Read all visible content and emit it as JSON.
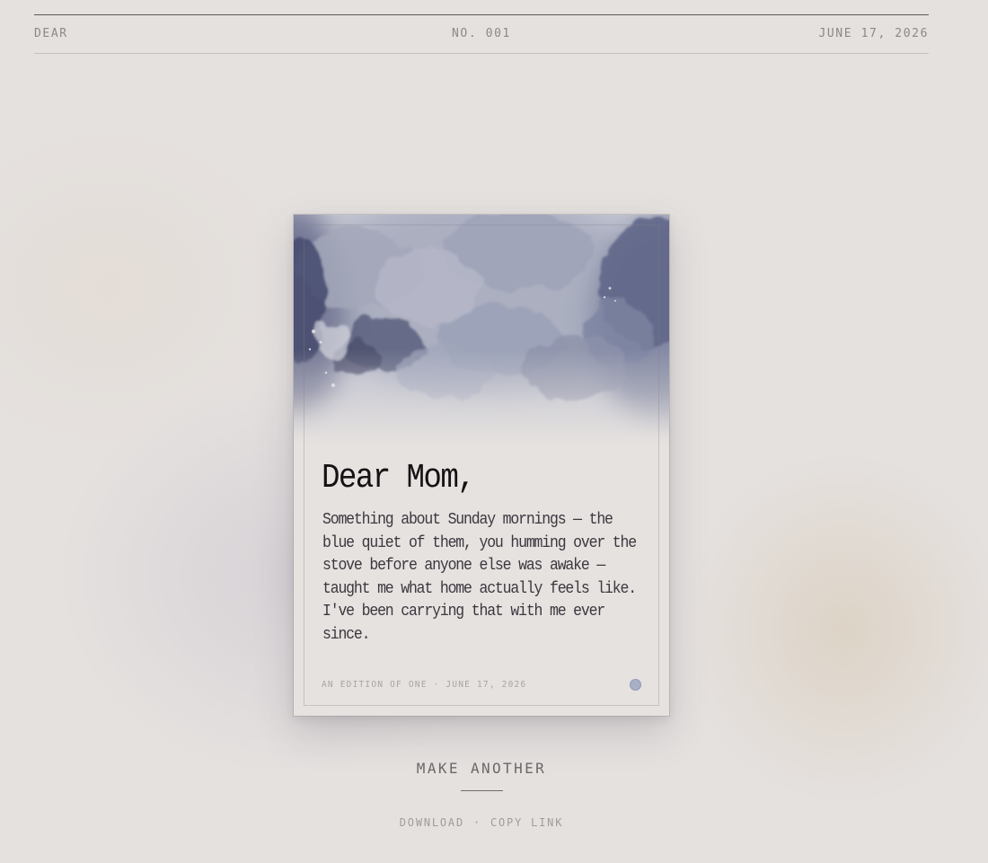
{
  "masthead": {
    "left": "DEAR",
    "center": "NO. 001",
    "right": "JUNE 17, 2026"
  },
  "card": {
    "artwork": "watercolor-clouds",
    "greeting": "Dear Mom,",
    "message": "Something about Sunday mornings — the blue quiet of them, you humming over the stove before anyone else was awake — taught me what home actually feels like. I've been carrying that with me ever since.",
    "footer": "AN EDITION OF ONE · JUNE 17, 2026",
    "accent_color": "#a8b0c6"
  },
  "actions": {
    "make_another": "MAKE ANOTHER",
    "download": "DOWNLOAD",
    "separator": "·",
    "copy_link": "COPY LINK"
  }
}
